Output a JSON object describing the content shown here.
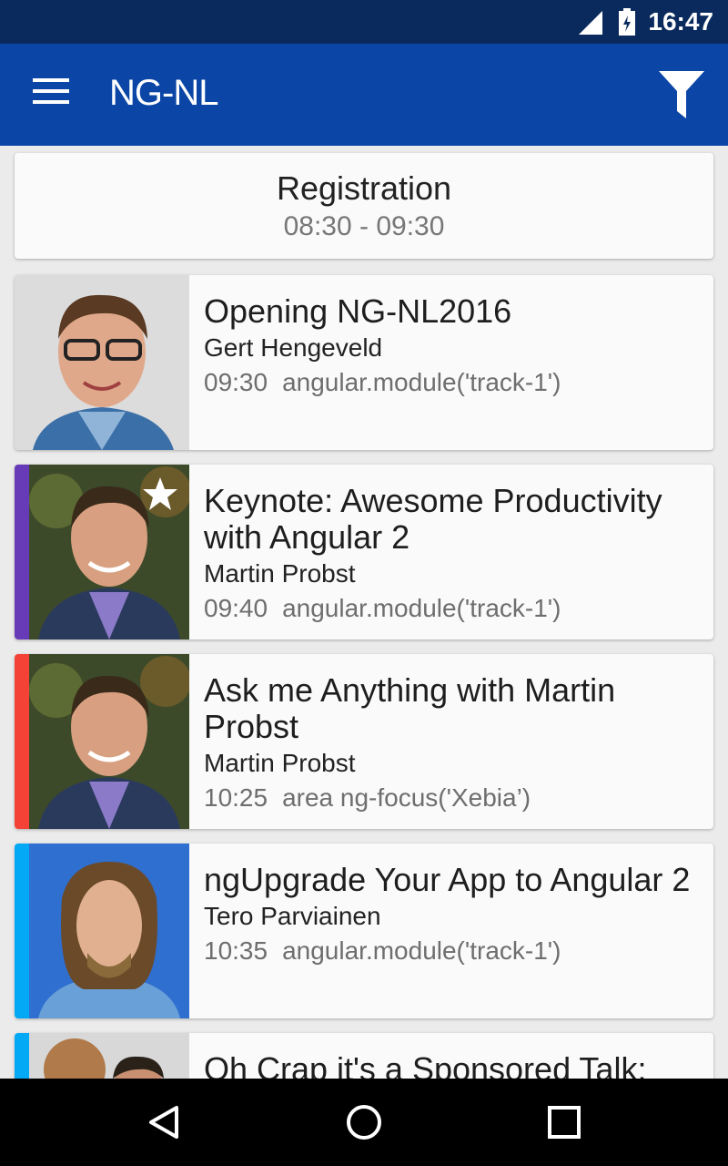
{
  "status_bar": {
    "time": "16:47"
  },
  "app_bar": {
    "title": "NG-NL"
  },
  "registration": {
    "title": "Registration",
    "time": "08:30 - 09:30"
  },
  "sessions": [
    {
      "title": "Opening NG-NL2016",
      "speaker": "Gert Hengeveld",
      "time": "09:30",
      "track": "angular.module('track-1')",
      "stripe_color": "",
      "favorite": false
    },
    {
      "title": "Keynote: Awesome Productivity with Angular 2",
      "speaker": "Martin Probst",
      "time": "09:40",
      "track": "angular.module('track-1')",
      "stripe_color": "#673ab7",
      "favorite": true
    },
    {
      "title": "Ask me Anything with Martin Probst",
      "speaker": "Martin Probst",
      "time": "10:25",
      "track": "area ng-focus('Xebia’)",
      "stripe_color": "#f44336",
      "favorite": false
    },
    {
      "title": "ngUpgrade Your App to Angular 2",
      "speaker": "Tero Parviainen",
      "time": "10:35",
      "track": "angular.module('track-1')",
      "stripe_color": "#03a9f4",
      "favorite": false
    },
    {
      "title": "Oh Crap it's a Sponsored Talk:",
      "stripe_color": "#03a9f4"
    }
  ],
  "colors": {
    "status_bar": "#0a2a5e",
    "app_bar": "#0b46a6",
    "card": "#fafafa",
    "background": "#ebebeb"
  },
  "icons": {
    "menu": "hamburger-icon",
    "filter": "filter-icon",
    "favorite": "star-icon",
    "back": "back-triangle-icon",
    "home": "home-circle-icon",
    "recents": "recents-square-icon"
  }
}
